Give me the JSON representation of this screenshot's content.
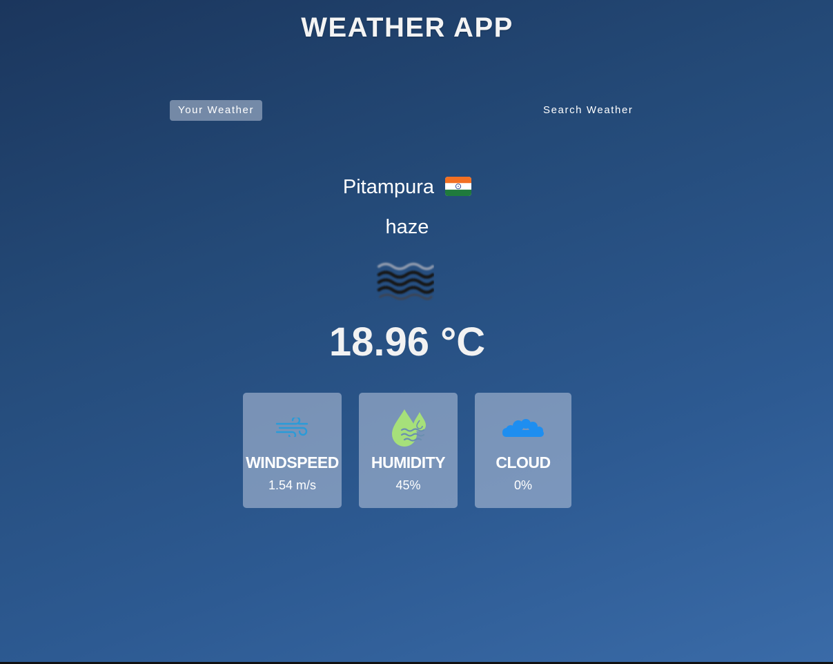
{
  "header": {
    "title": "WEATHER APP"
  },
  "tabs": [
    {
      "label": "Your Weather",
      "active": true
    },
    {
      "label": "Search Weather",
      "active": false
    }
  ],
  "location": {
    "city": "Pitampura",
    "country_flag_icon": "india-flag-icon"
  },
  "weather": {
    "description": "haze",
    "icon": "haze-icon",
    "temperature": "18.96 °C"
  },
  "metrics": [
    {
      "label": "WINDSPEED",
      "value": "1.54 m/s",
      "icon": "wind-icon"
    },
    {
      "label": "HUMIDITY",
      "value": "45%",
      "icon": "humidity-icon"
    },
    {
      "label": "CLOUD",
      "value": "0%",
      "icon": "cloud-icon"
    }
  ],
  "colors": {
    "background_top": "#1b365d",
    "background_bottom": "#3a6ba8",
    "card_background": "#8a9dbc",
    "wind_icon": "#2a9bd8",
    "humidity_icon": "#a6e07a",
    "cloud_icon": "#1e8ef0"
  }
}
